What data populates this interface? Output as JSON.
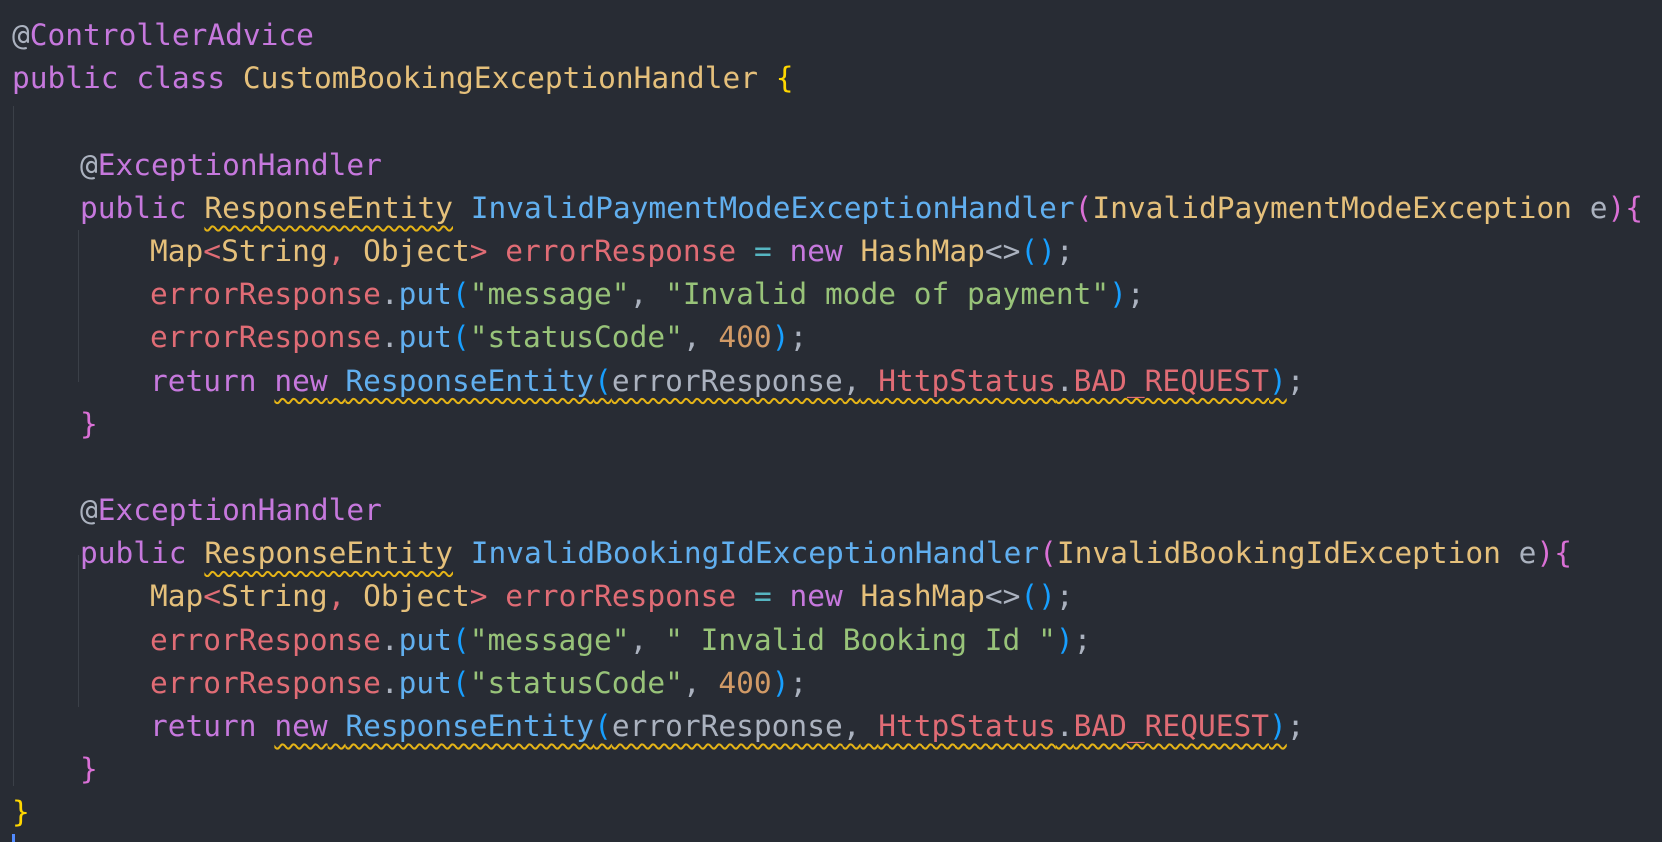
{
  "code": {
    "at": "@",
    "controller_advice": "ControllerAdvice",
    "public": "public",
    "class": "class",
    "class_name": "CustomBookingExceptionHandler",
    "open_brace": "{",
    "close_brace": "}",
    "exception_handler": "ExceptionHandler",
    "response_entity": "ResponseEntity",
    "map": "Map",
    "lt": "<",
    "gt": ">",
    "string": "String",
    "comma": ",",
    "object": "Object",
    "error_response": "errorResponse",
    "eq": "=",
    "new": "new",
    "hashmap": "HashMap",
    "diamond": "<>",
    "lparen": "(",
    "rparen": ")",
    "semi": ";",
    "dot": ".",
    "put": "put",
    "key_message": "\"message\"",
    "key_status": "\"statusCode\"",
    "status_code": "400",
    "return": "return",
    "http_status": "HttpStatus",
    "bad_request": "BAD_REQUEST",
    "param_e": "e",
    "handler1": {
      "method": "InvalidPaymentModeExceptionHandler",
      "exception_type": "InvalidPaymentModeException",
      "message": "\"Invalid mode of payment\""
    },
    "handler2": {
      "method": "InvalidBookingIdExceptionHandler",
      "exception_type": "InvalidBookingIdException",
      "message": "\" Invalid Booking Id \""
    }
  },
  "colors": {
    "background": "#282c34",
    "keyword": "#c678dd",
    "type": "#e5c07b",
    "function": "#61afef",
    "variable": "#e06c75",
    "string": "#98c379",
    "number": "#d19a66",
    "warning_squiggle": "#e5b417"
  }
}
